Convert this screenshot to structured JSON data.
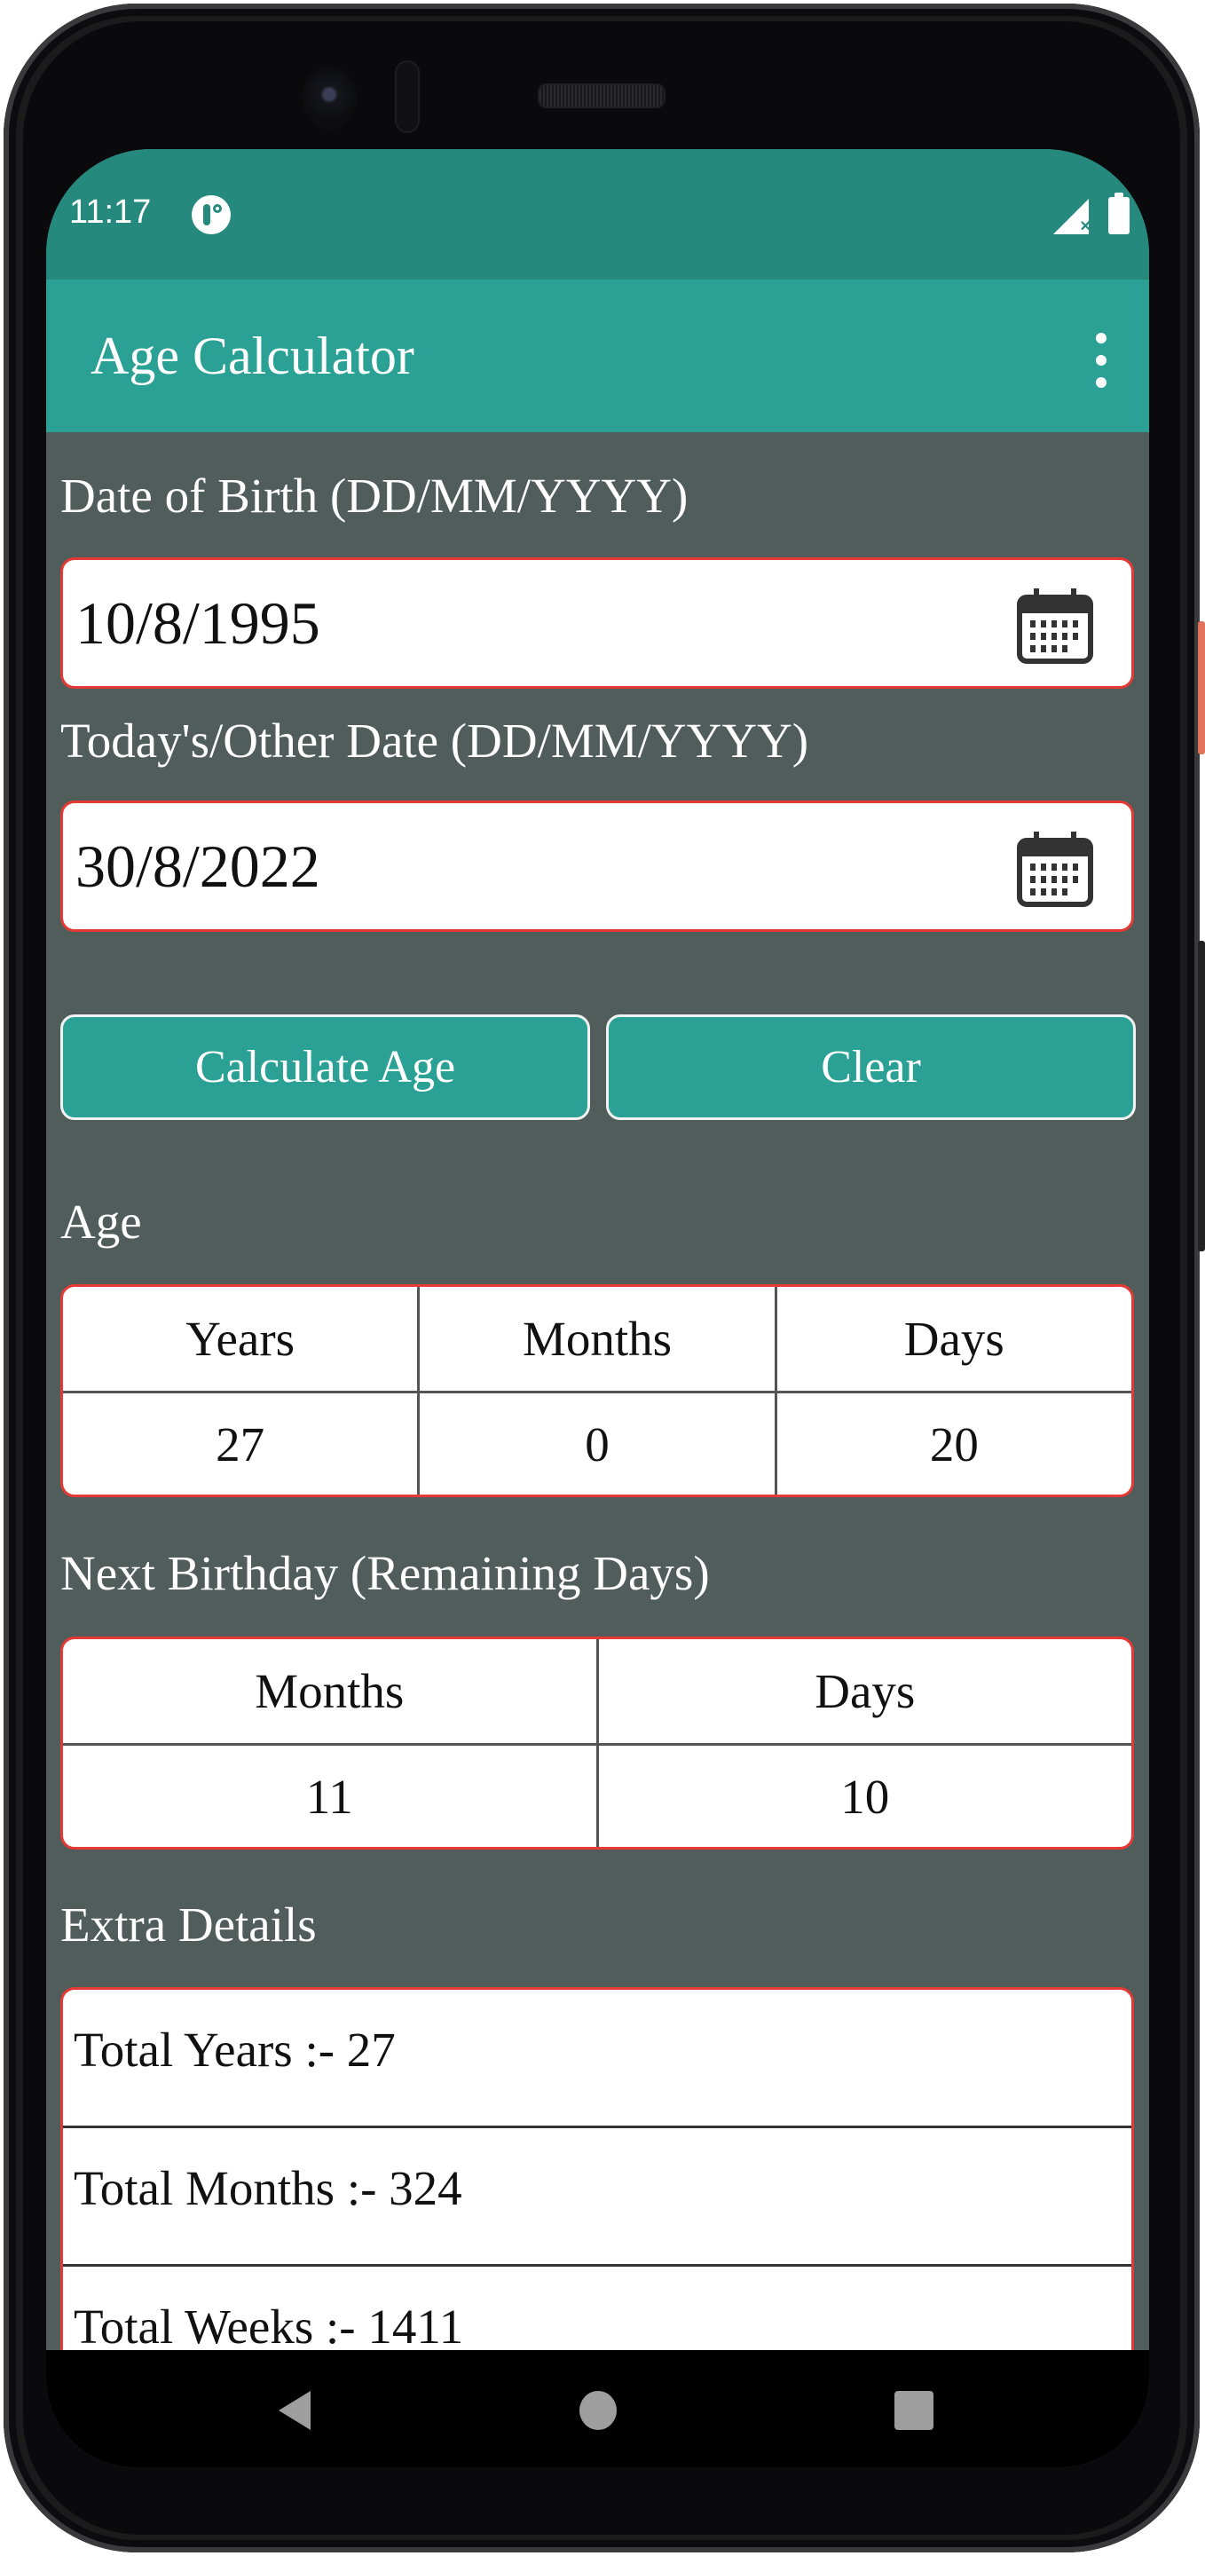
{
  "status_bar": {
    "time": "11:17",
    "icons": [
      "app-notification-icon",
      "signal-no-service-icon",
      "battery-icon"
    ]
  },
  "app_bar": {
    "title": "Age Calculator",
    "menu_icon": "more-vert-icon"
  },
  "form": {
    "dob_label": "Date of Birth (DD/MM/YYYY)",
    "dob_value": "10/8/1995",
    "other_label": "Today's/Other Date (DD/MM/YYYY)",
    "other_value": "30/8/2022",
    "calendar_icon": "calendar-icon"
  },
  "buttons": {
    "calculate": "Calculate Age",
    "clear": "Clear"
  },
  "age": {
    "title": "Age",
    "headers": [
      "Years",
      "Months",
      "Days"
    ],
    "values": [
      "27",
      "0",
      "20"
    ]
  },
  "next_birthday": {
    "title": "Next Birthday (Remaining Days)",
    "headers": [
      "Months",
      "Days"
    ],
    "values": [
      "11",
      "10"
    ]
  },
  "extra_details": {
    "title": "Extra Details",
    "rows": [
      "Total Years :- 27",
      "Total Months :- 324",
      "Total Weeks :- 1411"
    ]
  },
  "nav_bar": {
    "buttons": [
      "back",
      "home",
      "recents"
    ]
  },
  "colors": {
    "status_bar": "#258a7d",
    "app_bar": "#2ba195",
    "background": "#505d5a",
    "field_border": "#e53935"
  }
}
